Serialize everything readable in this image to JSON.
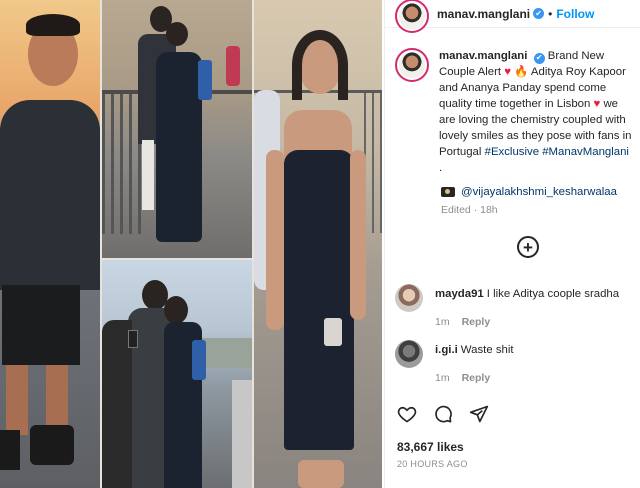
{
  "header": {
    "username": "manav.manglani",
    "verified_icon": "✔",
    "separator": "•",
    "follow_label": "Follow"
  },
  "post": {
    "caption_lines": [
      "Brand New",
      "Couple Alert",
      "Aditya Roy Kapoor",
      "and Ananya Panday spend come",
      "quality time together in Lisbon",
      "we",
      "are loving the chemistry coupled with",
      "lovely smiles as they pose with fans in",
      "Portugal",
      "#Exclusive #ManavManglani",
      "."
    ],
    "credit_mention": "@vijayalakhshmi_kesharwalaa",
    "edited": "Edited · 18h",
    "heart_glyph": "♥",
    "fire_glyph": "🔥"
  },
  "comments": [
    {
      "username": "mayda91",
      "text": "I like Aditya coople sradha",
      "time": "1m",
      "reply_label": "Reply"
    },
    {
      "username": "i.gi.i",
      "text": "Waste shit",
      "time": "1m",
      "reply_label": "Reply"
    }
  ],
  "likes": "83,667 likes",
  "timestamp": "20 HOURS AGO",
  "colors": {
    "follow": "#0095f6",
    "verified": "#3897f0",
    "heart": "#ed1c3a",
    "hashtag": "#00376b",
    "muted": "#8e8e8e"
  }
}
